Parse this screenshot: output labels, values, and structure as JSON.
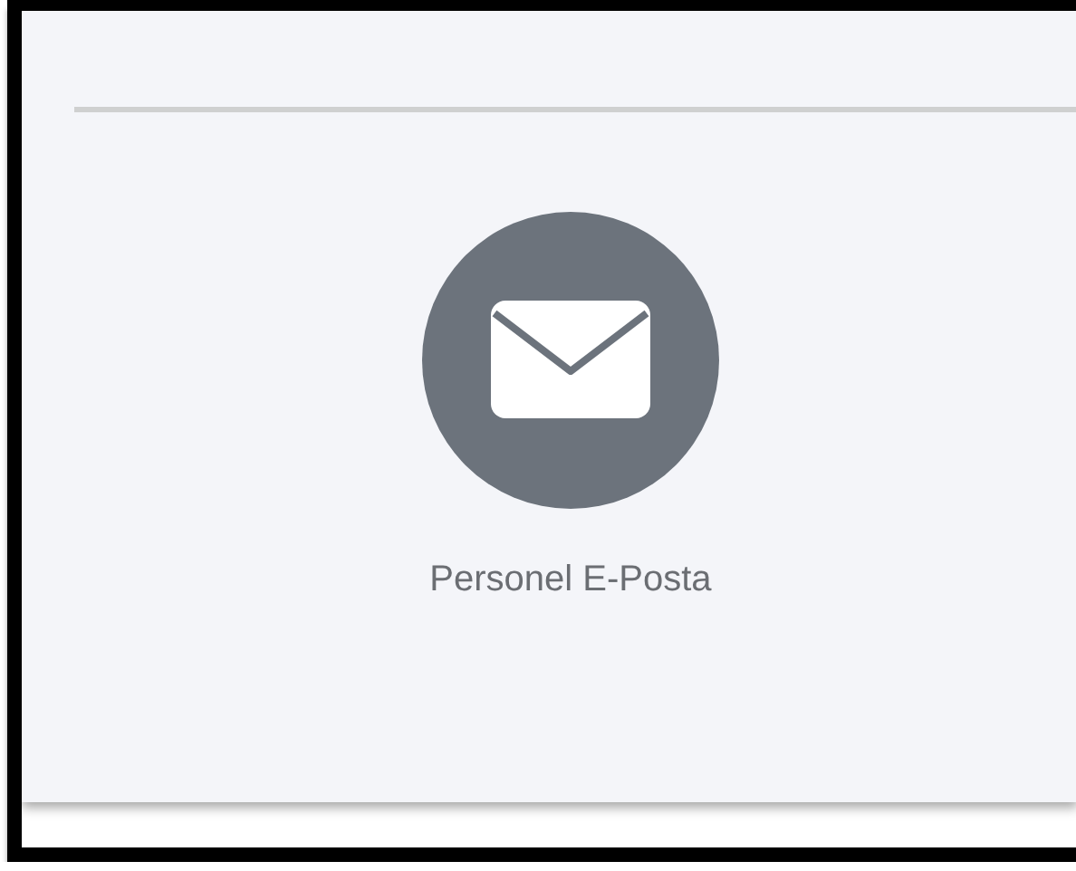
{
  "tile": {
    "label": "Personel E-Posta"
  }
}
